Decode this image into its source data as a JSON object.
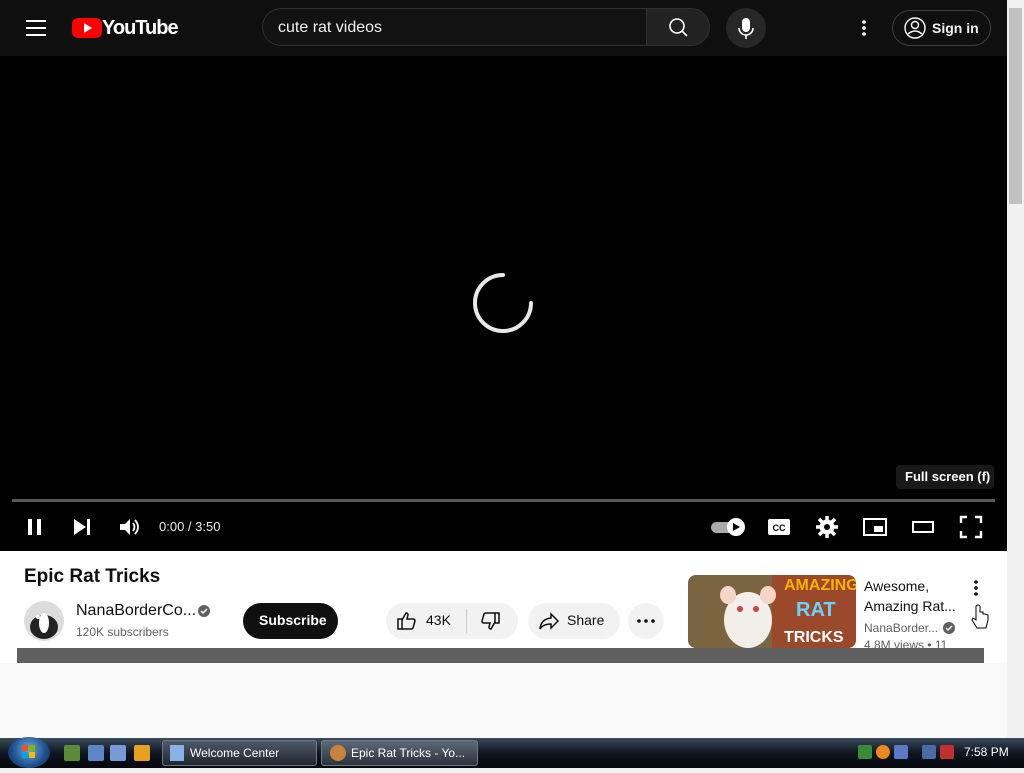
{
  "header": {
    "logo_text": "YouTube",
    "search_value": "cute rat videos",
    "sign_in_label": "Sign in"
  },
  "player": {
    "time": "0:00 / 3:50",
    "progress": 0,
    "tooltip": "Full screen (f)"
  },
  "video": {
    "title": "Epic Rat Tricks",
    "channel": "NanaBorderCo...",
    "subscribers": "120K subscribers",
    "subscribe_label": "Subscribe",
    "likes": "43K",
    "share_label": "Share"
  },
  "recommendation": {
    "title": "Awesome, Amazing Rat...",
    "channel": "NanaBorder...",
    "meta": "4.8M views • 11",
    "thumb_text_1": "AMAZING",
    "thumb_text_2": "RAT",
    "thumb_text_3": "TRICKS"
  },
  "taskbar": {
    "tasks": [
      {
        "label": "Welcome Center"
      },
      {
        "label": "Epic Rat Tricks - Yo..."
      }
    ],
    "clock": "7:58 PM"
  },
  "colors": {
    "youtube_red": "#ff0000",
    "dark_bg": "#0f0f0f"
  }
}
